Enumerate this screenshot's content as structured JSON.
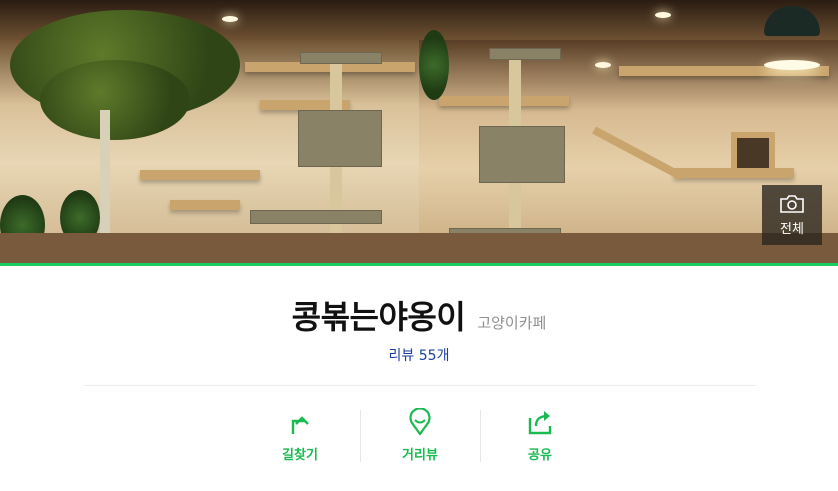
{
  "hero": {
    "images": [
      "cafe-photo-left",
      "cafe-photo-right"
    ],
    "gallery_button": {
      "label": "전체",
      "icon": "camera-icon"
    }
  },
  "place": {
    "name": "콩볶는야옹이",
    "category": "고양이카페",
    "review_label": "리뷰 55개"
  },
  "actions": [
    {
      "label": "길찾기",
      "icon": "directions-icon"
    },
    {
      "label": "거리뷰",
      "icon": "map-pin-icon"
    },
    {
      "label": "공유",
      "icon": "share-icon"
    }
  ],
  "colors": {
    "accent_green": "#19ce60",
    "action_green": "#19ba4f",
    "review_blue": "#1b3fa0"
  }
}
